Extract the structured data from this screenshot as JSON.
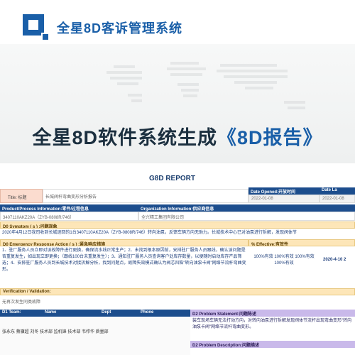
{
  "header": {
    "title": "全星8D客诉管理系统"
  },
  "hero": {
    "title_main": "全星8D软件系统生成",
    "title_accent": "《8D报告》"
  },
  "report": {
    "title": "G8D REPORT",
    "title_label": "Title: 标题",
    "title_value": "长城阀杆弯曲变形分析报告",
    "date_opened_label": "Date Opened:开放时间",
    "date_opened_value": "2022-01-08",
    "date_last_label": "Date La",
    "date_last_value": "2022-01-08",
    "product_label": "Product/Process Information:零件/过程信息",
    "product_value": "3407110AKZ20A（ZYB-0808R/746）",
    "org_label": "Organization Information:供应商信息",
    "org_value": "全兴精工集团有限公司",
    "symptom_label": "D0 Symptom ( s ) :问题现象",
    "symptom_text": "2020年4月12日我司收到长城退回的1台3407110AKZ20A（ZYB-0808R/746）转向油泵，反馈车辆方向无助力。长城技术中心已对油泵进行拆解，发现阀体节",
    "era_label": "D0 Emergency Response Action ( s ) :紧急响应措施",
    "era_text": "1、驻厂服务人员立即对该故障件进行更换，确保流水线正常生产；2、未找到根本原因前，安排驻厂服务人员跟线，确认该问题是否重复发生，如出现立即更换；（跟线100台未重复发生）；3、通知驻厂服务人员查询客户处库存数量，以便随时启动库存产品筛选；4、安排驻厂服务人员到长城技术对接拆解分析，找到问题点，故障失效模式确认为阀芯凹陷\"转向油泵卡阀\"网络节流杆弯曲变形。",
    "effective_label": "% Effective:有效性",
    "effective_value": "100%有效 100%有效 100%有效 100%有效",
    "effective_date": "2020-4-10 2",
    "verification_label": "Verification / Validation:",
    "verification_value": "无再次发生同类故障",
    "team": {
      "header": "D1 Team:",
      "name_col": "Name",
      "dept_col": "Dept",
      "phone_col": "Phone",
      "members": "张永东 蔡骥超 刘冬 技术部 监机锋 技术部 韦栉华 质量部"
    },
    "d2_label": "D2 Problem Statement:问题陈述",
    "d2_text": "装车现场车辆无法打动方向，对转向油泵进行拆解发现阀体节流杆出现弯曲变形\"转向油泵卡阀\"网络节流杆弯曲变形。",
    "d2_desc_label": "D2 Problem Description:问题描述"
  }
}
